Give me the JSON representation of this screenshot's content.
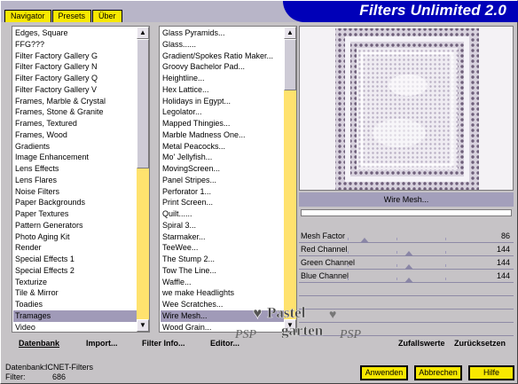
{
  "app": {
    "title": "Filters Unlimited 2.0"
  },
  "tabs": [
    {
      "label": "Navigator",
      "active": true
    },
    {
      "label": "Presets",
      "active": false
    },
    {
      "label": "Über",
      "active": false
    }
  ],
  "categories": [
    "Edges, Square",
    "FFG???",
    "Filter Factory Gallery G",
    "Filter Factory Gallery N",
    "Filter Factory Gallery Q",
    "Filter Factory Gallery V",
    "Frames, Marble & Crystal",
    "Frames, Stone & Granite",
    "Frames, Textured",
    "Frames, Wood",
    "Gradients",
    "Image Enhancement",
    "Lens Effects",
    "Lens Flares",
    "Noise Filters",
    "Paper Backgrounds",
    "Paper Textures",
    "Pattern Generators",
    "Photo Aging Kit",
    "Render",
    "Special Effects 1",
    "Special Effects 2",
    "Texturize",
    "Tile & Mirror",
    "Toadies",
    "Tramages",
    "Video"
  ],
  "selected_category": "Tramages",
  "filters": [
    "Glass Pyramids...",
    "Glass......",
    "Gradient/Spokes Ratio Maker...",
    "Groovy Bachelor Pad...",
    "Heightline...",
    "Hex Lattice...",
    "Holidays in Egypt...",
    "Legolator...",
    "Mapped Thingies...",
    "Marble Madness One...",
    "Metal Peacocks...",
    "Mo' Jellyfish...",
    "MovingScreen...",
    "Panel Stripes...",
    "Perforator 1...",
    "Print Screen...",
    "Quilt......",
    "Spiral 3...",
    "Starmaker...",
    "TeeWee...",
    "The Stump 2...",
    "Tow The Line...",
    "Waffle...",
    "we make Headlights",
    "Wee Scratches...",
    "Wire Mesh...",
    "Wood Grain..."
  ],
  "selected_filter": "Wire Mesh...",
  "preview_label": "Wire Mesh...",
  "sliders": [
    {
      "label": "Mesh Factor",
      "value": "86",
      "fraction": 0.337
    },
    {
      "label": "Red Channel",
      "value": "144",
      "fraction": 0.565
    },
    {
      "label": "Green Channel",
      "value": "144",
      "fraction": 0.565
    },
    {
      "label": "Blue Channel",
      "value": "144",
      "fraction": 0.565
    }
  ],
  "toolbar": {
    "datenbank": "Datenbank",
    "import": "Import...",
    "filter_info": "Filter Info...",
    "editor": "Editor...",
    "zufallswerte": "Zufallswerte",
    "zuruecksetzen": "Zurücksetzen"
  },
  "status": {
    "database_label": "Datenbank:",
    "database_value": "ICNET-Filters",
    "filter_label": "Filter:",
    "filter_value": "686"
  },
  "buttons": {
    "apply": "Anwenden",
    "cancel": "Abbrechen",
    "help": "Hilfe"
  },
  "watermark": {
    "line1": "Pastel",
    "line2": "garten"
  },
  "colors": {
    "brand": "#0000b8",
    "accent": "#f8e800",
    "selection": "#a09ab8"
  }
}
